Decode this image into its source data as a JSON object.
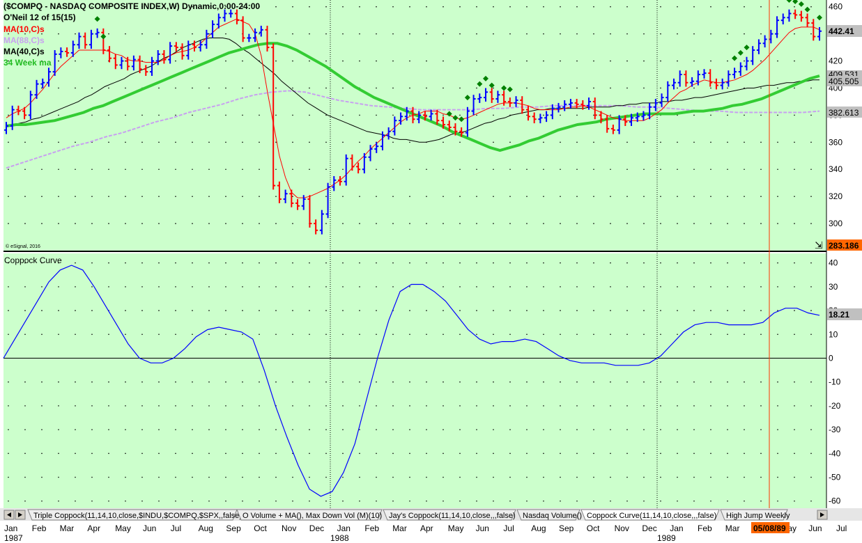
{
  "header": {
    "symbol_line": "($COMPQ - NASDAQ COMPOSITE INDEX,W) Dynamic,0:00-24:00",
    "study_line": "O'Neil 12 of 15(15)",
    "legend": [
      {
        "label": "MA(10,C)s",
        "color": "#ff0000"
      },
      {
        "label": "MA(88,C)s",
        "color": "#c8a0f0"
      },
      {
        "label": "MA(40,C)s",
        "color": "#000000"
      },
      {
        "label": "34 Week ma",
        "color": "#22bb22"
      }
    ],
    "copyright": "© eSignal, 2016"
  },
  "lower_panel": {
    "title": "Coppock Curve"
  },
  "price_labels": {
    "last": "442.41",
    "ma40": "409.531",
    "ma10": "405.505",
    "ma88": "382.613",
    "low": "283.186"
  },
  "coppock_label": "18.21",
  "cursor_date": "05/08/89",
  "tabs": [
    "Triple Coppock(11,14,10,close,$INDU,$COMPQ,$SPX,,false)",
    "O Volume + MA(), Max Down Vol (M)(10)",
    "Jay's Coppock(11,14,10,close,,,false)",
    "Nasdaq Volume()",
    "Coppock Curve(11,14,10,close,,,false)",
    "High Jump Weekly"
  ],
  "active_tab": 4,
  "colors": {
    "background": "#ccffcc",
    "up_bar": "#0000ff",
    "down_bar": "#ff0000",
    "signal": "#008000",
    "coppock": "#0000ff",
    "price_label_bg": "#c0c0c0",
    "low_label_bg": "#ff6600",
    "cursor_label_bg": "#ff6600"
  },
  "chart_data": [
    {
      "type": "ohlc",
      "title": "$COMPQ - NASDAQ COMPOSITE INDEX,W",
      "ylim": [
        280,
        465
      ],
      "y_ticks": [
        300,
        320,
        340,
        360,
        380,
        400,
        420,
        440,
        460
      ],
      "x_month_labels": [
        "Jan",
        "Feb",
        "Mar",
        "Apr",
        "May",
        "Jun",
        "Jul",
        "Aug",
        "Sep",
        "Oct",
        "Nov",
        "Dec",
        "Jan",
        "Feb",
        "Mar",
        "Apr",
        "May",
        "Jun",
        "Jul",
        "Aug",
        "Sep",
        "Oct",
        "Nov",
        "Dec",
        "Jan",
        "Feb",
        "Mar",
        "Apr",
        "May",
        "Jun",
        "Jul"
      ],
      "x_year_labels": [
        "1987",
        "1988",
        "1989"
      ],
      "close": [
        372,
        384,
        383,
        380,
        395,
        403,
        404,
        412,
        425,
        427,
        426,
        432,
        438,
        432,
        440,
        441,
        428,
        422,
        417,
        420,
        416,
        421,
        414,
        412,
        420,
        425,
        421,
        431,
        430,
        424,
        432,
        430,
        432,
        440,
        447,
        452,
        455,
        455,
        450,
        437,
        437,
        441,
        443,
        430,
        328,
        318,
        322,
        315,
        313,
        318,
        300,
        295,
        307,
        327,
        332,
        331,
        348,
        342,
        340,
        349,
        355,
        357,
        365,
        368,
        376,
        379,
        383,
        377,
        380,
        379,
        381,
        376,
        373,
        371,
        368,
        367,
        383,
        392,
        393,
        397,
        392,
        395,
        390,
        389,
        391,
        384,
        379,
        377,
        378,
        380,
        385,
        386,
        388,
        389,
        388,
        387,
        390,
        380,
        377,
        370,
        369,
        377,
        375,
        378,
        379,
        380,
        386,
        389,
        393,
        402,
        404,
        410,
        404,
        405,
        410,
        411,
        404,
        402,
        404,
        410,
        412,
        416,
        420,
        428,
        433,
        436,
        440,
        450,
        452,
        455,
        454,
        452,
        448,
        438,
        442
      ],
      "ma10": [
        378,
        381,
        383,
        385,
        389,
        394,
        399,
        405,
        411,
        416,
        420,
        424,
        428,
        428,
        428,
        428,
        428,
        427,
        425,
        424,
        421,
        420,
        420,
        419,
        419,
        419,
        421,
        424,
        426,
        427,
        428,
        430,
        433,
        437,
        441,
        445,
        447,
        449,
        451,
        449,
        447,
        440,
        424,
        398,
        374,
        350,
        334,
        323,
        319,
        319,
        320,
        322,
        324,
        326,
        329,
        332,
        336,
        341,
        346,
        350,
        355,
        359,
        363,
        367,
        371,
        375,
        378,
        380,
        381,
        383,
        383,
        383,
        381,
        380,
        378,
        377,
        378,
        380,
        382,
        384,
        386,
        388,
        389,
        389,
        389,
        388,
        387,
        385,
        384,
        384,
        384,
        384,
        385,
        386,
        386,
        387,
        386,
        384,
        382,
        380,
        378,
        377,
        376,
        376,
        376,
        376,
        378,
        381,
        384,
        389,
        393,
        397,
        399,
        402,
        404,
        406,
        405,
        404,
        404,
        405,
        406,
        408,
        410,
        413,
        417,
        421,
        426,
        431,
        436,
        441,
        444,
        445,
        445,
        445,
        443
      ],
      "ma40": [
        372,
        373,
        374,
        375,
        377,
        378,
        380,
        382,
        384,
        386,
        388,
        390,
        393,
        395,
        398,
        401,
        403,
        405,
        407,
        410,
        412,
        414,
        416,
        419,
        422,
        424,
        427,
        430,
        432,
        434,
        436,
        437,
        437,
        437,
        436,
        433,
        429,
        426,
        422,
        418,
        414,
        410,
        405,
        401,
        397,
        393,
        389,
        386,
        383,
        380,
        378,
        376,
        374,
        372,
        370,
        368,
        367,
        366,
        365,
        363,
        362,
        362,
        361,
        360,
        360,
        361,
        362,
        364,
        366,
        367,
        368,
        370,
        372,
        374,
        375,
        377,
        378,
        380,
        381,
        382,
        383,
        384,
        384,
        385,
        385,
        385,
        385,
        385,
        385,
        386,
        386,
        386,
        386,
        387,
        387,
        388,
        388,
        389,
        389,
        389,
        390,
        390,
        391,
        391,
        392,
        393,
        393,
        394,
        395,
        396,
        397,
        398,
        399,
        400,
        400,
        401,
        402,
        402,
        403,
        404,
        404,
        405,
        405,
        406,
        406
      ],
      "ma34": [
        372,
        373,
        373,
        374,
        375,
        376,
        378,
        380,
        382,
        385,
        387,
        390,
        393,
        396,
        399,
        402,
        405,
        408,
        411,
        414,
        417,
        420,
        423,
        426,
        428,
        430,
        432,
        433,
        433,
        431,
        428,
        424,
        420,
        416,
        411,
        406,
        401,
        397,
        393,
        390,
        387,
        384,
        381,
        378,
        375,
        372,
        368,
        365,
        362,
        359,
        356,
        354,
        356,
        358,
        361,
        363,
        366,
        369,
        371,
        373,
        374,
        375,
        377,
        378,
        379,
        380,
        381,
        381,
        381,
        381,
        382,
        383,
        383,
        384,
        385,
        387,
        388,
        390,
        392,
        395,
        398,
        401,
        404,
        407,
        409
      ],
      "ma88": [
        341,
        345,
        349,
        353,
        357,
        360,
        364,
        367,
        371,
        375,
        378,
        382,
        385,
        388,
        392,
        395,
        397,
        398,
        397,
        394,
        391,
        389,
        387,
        386,
        385,
        384,
        384,
        384,
        384,
        385,
        385,
        386,
        386,
        387,
        387,
        387,
        387,
        387,
        386,
        386,
        385,
        384,
        383,
        383,
        382,
        382,
        382,
        382,
        382,
        383
      ]
    },
    {
      "type": "line",
      "title": "Coppock Curve",
      "ylim": [
        -63,
        44
      ],
      "y_ticks": [
        -60,
        -50,
        -40,
        -30,
        -20,
        -10,
        0,
        10,
        20,
        30,
        40
      ],
      "values": [
        0,
        8,
        16,
        24,
        32,
        37,
        39,
        37,
        30,
        22,
        14,
        6,
        0,
        -2,
        -2,
        0,
        4,
        9,
        12,
        13,
        12,
        11,
        8,
        -5,
        -20,
        -33,
        -45,
        -55,
        -58,
        -56,
        -48,
        -36,
        -18,
        0,
        16,
        28,
        31,
        31,
        28,
        24,
        18,
        12,
        8,
        6,
        7,
        7,
        8,
        7,
        4,
        1,
        -1,
        -2,
        -2,
        -2,
        -3,
        -3,
        -3,
        -2,
        1,
        6,
        11,
        14,
        15,
        15,
        14,
        14,
        14,
        15,
        19,
        21,
        21,
        19,
        18
      ]
    }
  ]
}
